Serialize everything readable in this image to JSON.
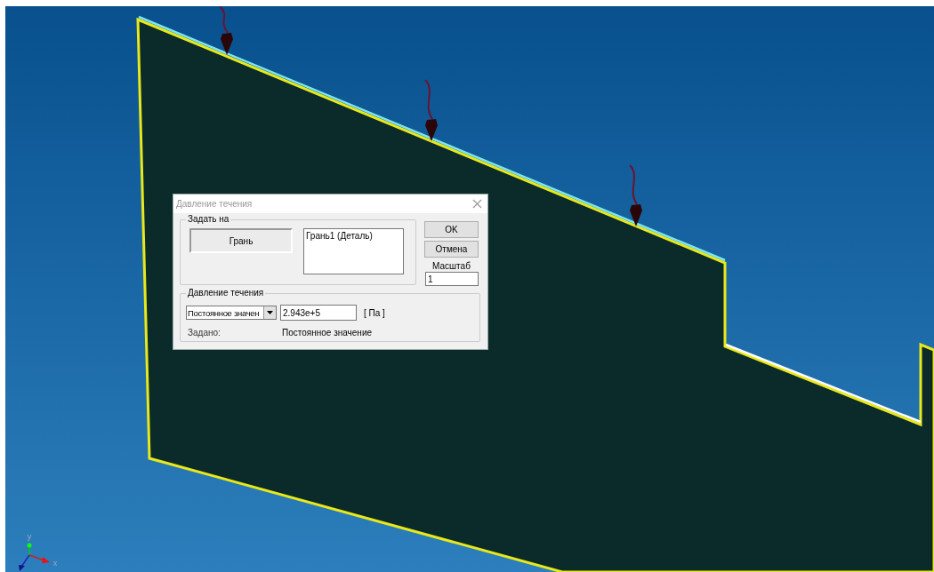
{
  "viewport": {
    "axes": [
      {
        "label": "y"
      },
      {
        "label": "x"
      }
    ]
  },
  "dialog": {
    "title": "Давление течения",
    "apply_to": {
      "legend": "Задать на",
      "toggle": {
        "label": "Грань",
        "pressed": true
      },
      "list_items": [
        {
          "label": "Грань1 (Деталь)",
          "selected": false
        }
      ]
    },
    "buttons": [
      {
        "label": "OK"
      },
      {
        "label": "Отмена"
      }
    ],
    "scale": {
      "label": "Масштаб",
      "value": "1"
    },
    "pressure": {
      "legend": "Давление течения",
      "mode": "Постоянное значен",
      "value": "2.943e+5",
      "unit": "[ Па ]",
      "status_label": "Задано:",
      "status_value": "Постоянное значение"
    }
  }
}
